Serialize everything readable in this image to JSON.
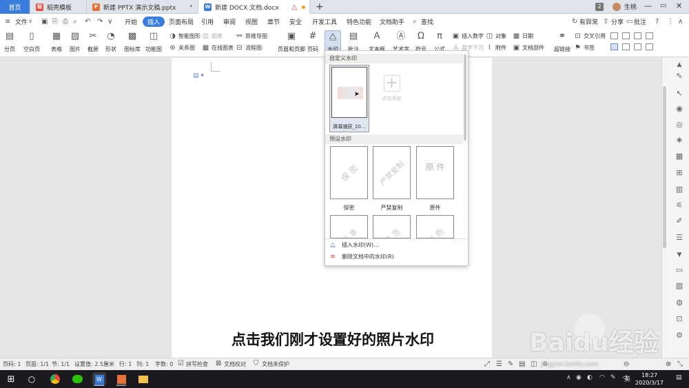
{
  "tabs": [
    {
      "label": "首页"
    },
    {
      "label": "稻壳模板",
      "icon": "docer-icon"
    },
    {
      "label": "新建 PPTX 演示文稿.pptx",
      "icon": "ppt-icon"
    },
    {
      "label": "新建 DOCX 文档.docx",
      "icon": "word-icon"
    }
  ],
  "titlebar": {
    "page_count": "2",
    "user": "生桃"
  },
  "menubar": {
    "file": "文件",
    "items": [
      "开始",
      "插入",
      "页面布局",
      "引用",
      "审阅",
      "视图",
      "章节",
      "安全",
      "开发工具",
      "特色功能",
      "文档助手"
    ],
    "active_item": "插入",
    "search": "查找",
    "right": [
      "有异常",
      "分享",
      "批注"
    ]
  },
  "ribbon": {
    "big": [
      "分页",
      "空白页",
      "表格",
      "图片",
      "截屏",
      "形状",
      "图标库",
      "功能图",
      "页眉和页脚",
      "页码",
      "水印",
      "批注",
      "文本框",
      "艺术字",
      "符号",
      "公式",
      "超链接"
    ],
    "small": [
      "智能图形",
      "图表",
      "思维导图",
      "关系图",
      "在线图表",
      "流程图",
      "插入数字",
      "对象",
      "日期",
      "首字下沉",
      "附件",
      "文档部件",
      "交叉引用",
      "书签"
    ],
    "dim": [
      "图表",
      "首字下沉"
    ]
  },
  "watermark_panel": {
    "custom_title": "自定义水印",
    "custom_item_caption": "屏幕捕获_20...",
    "add_label": "点击添加",
    "preset_title": "预设水印",
    "presets": [
      {
        "text": "保 密",
        "label": "保密"
      },
      {
        "text": "严禁复制",
        "label": "严禁复制"
      },
      {
        "text": "原 件",
        "label": "原件"
      }
    ],
    "bottom_row_partial": [
      "样 本",
      "紧 急",
      "样 色"
    ],
    "actions": [
      "插入水印(W)...",
      "删除文档中的水印(R)"
    ]
  },
  "caption": "点击我们刚才设置好的照片水印",
  "statusbar": {
    "items": [
      "页码: 1",
      "页面: 1/1",
      "节: 1/1",
      "设置值: 2.5厘米",
      "行: 1",
      "列: 1",
      "字数: 0",
      "拼写检查",
      "文档校对",
      "文档未保护"
    ]
  },
  "taskbar": {
    "tray_lang": "英",
    "time": "18:27",
    "date": "2020/3/17"
  },
  "watermark_brand": {
    "text": "Baidu经验",
    "url": "jingyan.baidu.com"
  },
  "colors": {
    "accent": "#3b7ddd",
    "tab_bar": "#dfe3ea",
    "taskbar": "#1b1b1f"
  }
}
